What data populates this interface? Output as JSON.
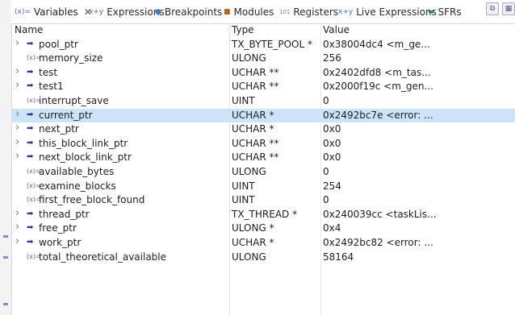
{
  "tabs": [
    {
      "label": "Variables",
      "icon": "(x)=",
      "active": true,
      "closable": true
    },
    {
      "label": "Expressions",
      "icon": "x+y",
      "active": false
    },
    {
      "label": "Breakpoints",
      "icon": "●",
      "active": false
    },
    {
      "label": "Modules",
      "icon": "■",
      "active": false
    },
    {
      "label": "Registers",
      "icon": "101",
      "active": false
    },
    {
      "label": "Live Expressions",
      "icon": "x+y",
      "active": false
    },
    {
      "label": "SFRs",
      "icon": "▬",
      "active": false
    }
  ],
  "columns": {
    "name": "Name",
    "type": "Type",
    "value": "Value"
  },
  "rows": [
    {
      "name": "pool_ptr",
      "type": "TX_BYTE_POOL *",
      "value": "0x38004dc4 <m_ge...",
      "expandable": true,
      "pointer": true
    },
    {
      "name": "memory_size",
      "type": "ULONG",
      "value": "256",
      "expandable": false,
      "pointer": false
    },
    {
      "name": "test",
      "type": "UCHAR **",
      "value": "0x2402dfd8 <m_tas...",
      "expandable": true,
      "pointer": true
    },
    {
      "name": "test1",
      "type": "UCHAR **",
      "value": "0x2000f19c <m_gen...",
      "expandable": true,
      "pointer": true
    },
    {
      "name": "interrupt_save",
      "type": "UINT",
      "value": "0",
      "expandable": false,
      "pointer": false
    },
    {
      "name": "current_ptr",
      "type": "UCHAR *",
      "value": "0x2492bc7e <error: ...",
      "expandable": true,
      "pointer": true,
      "selected": true
    },
    {
      "name": "next_ptr",
      "type": "UCHAR *",
      "value": "0x0",
      "expandable": true,
      "pointer": true
    },
    {
      "name": "this_block_link_ptr",
      "type": "UCHAR **",
      "value": "0x0",
      "expandable": true,
      "pointer": true
    },
    {
      "name": "next_block_link_ptr",
      "type": "UCHAR **",
      "value": "0x0",
      "expandable": true,
      "pointer": true
    },
    {
      "name": "available_bytes",
      "type": "ULONG",
      "value": "0",
      "expandable": false,
      "pointer": false
    },
    {
      "name": "examine_blocks",
      "type": "UINT",
      "value": "254",
      "expandable": false,
      "pointer": false
    },
    {
      "name": "first_free_block_found",
      "type": "UINT",
      "value": "0",
      "expandable": false,
      "pointer": false
    },
    {
      "name": "thread_ptr",
      "type": "TX_THREAD *",
      "value": "0x240039cc <taskLis...",
      "expandable": true,
      "pointer": true
    },
    {
      "name": "free_ptr",
      "type": "ULONG *",
      "value": "0x4",
      "expandable": true,
      "pointer": true
    },
    {
      "name": "work_ptr",
      "type": "UCHAR *",
      "value": "0x2492bc82 <error: ...",
      "expandable": true,
      "pointer": true
    },
    {
      "name": "total_theoretical_available",
      "type": "ULONG",
      "value": "58164",
      "expandable": false,
      "pointer": false
    }
  ],
  "colors": {
    "selection": "#cce4f7",
    "pointer_icon": "#1f3d8a",
    "primitive_icon": "#6b5fb0"
  }
}
